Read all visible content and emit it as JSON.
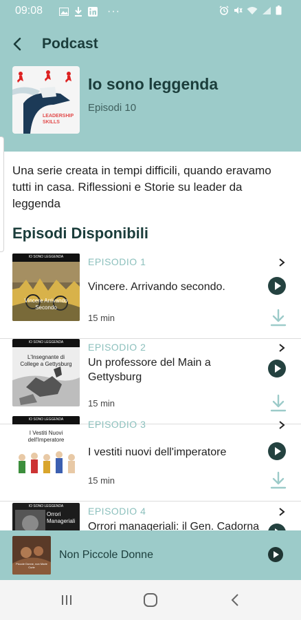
{
  "status_bar": {
    "time": "09:08",
    "dots": "···",
    "left_icons": [
      "image-icon",
      "download-icon",
      "linkedin-icon"
    ],
    "right_icons": [
      "alarm-icon",
      "mute-icon",
      "wifi-icon",
      "signal-icon",
      "battery-icon"
    ]
  },
  "header": {
    "title": "Podcast",
    "cover_text": "LEADERSHIP SKILLS"
  },
  "podcast": {
    "title": "Io sono leggenda",
    "episode_count": "Episodi 10",
    "description": "Una serie creata in tempi difficili, quando eravamo tutti in casa.  Riflessioni e Storie su leader da leggenda"
  },
  "section": {
    "title": "Episodi Disponibili"
  },
  "episodes": [
    {
      "label": "EPISODIO 1",
      "title": "Vincere. Arrivando secondo.",
      "duration": "15 min",
      "thumb_header": "IO SONO LEGGENDA",
      "thumb_caption": "Vincere Arrivando Secondo"
    },
    {
      "label": "EPISODIO 2",
      "title": "Un professore del Main a Gettysburg",
      "duration": "15 min",
      "thumb_header": "IO SONO LEGGENDA",
      "thumb_caption": "L'Insegnante di College a Gettysburg"
    },
    {
      "label": "EPISODIO 3",
      "title": "I vestiti nuovi dell'imperatore",
      "duration": "15 min",
      "thumb_header": "IO SONO LEGGENDA",
      "thumb_caption": "I Vestiti Nuovi dell'Imperatore"
    },
    {
      "label": "EPISODIO 4",
      "title": "Orrori manageriali: il Gen. Cadorna",
      "duration": "",
      "thumb_header": "IO SONO LEGGENDA",
      "thumb_caption": "Orrori Manageriali"
    }
  ],
  "mini_player": {
    "title": "Non Piccole Donne",
    "thumb_caption": "Piccole Donne, non Marie Curie"
  },
  "colors": {
    "header_bg": "#9ccbc9",
    "accent_dark": "#1b3d3b",
    "episode_label": "#8cc0bd"
  }
}
